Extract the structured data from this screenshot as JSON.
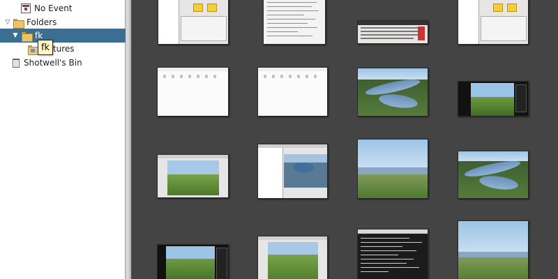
{
  "sidebar": {
    "items": [
      {
        "label": "No Event",
        "icon": "calendar-event-icon"
      },
      {
        "label": "Folders",
        "icon": "folder-icon"
      },
      {
        "label": "fk",
        "icon": "folder-icon"
      },
      {
        "label": "Pictures",
        "icon": "folder-pictures-icon"
      },
      {
        "label": "Shotwell's Bin",
        "icon": "trash-icon"
      }
    ],
    "tooltip": "fk"
  },
  "colors": {
    "selection": "#3a6f93",
    "viewer_background": "#444444"
  }
}
